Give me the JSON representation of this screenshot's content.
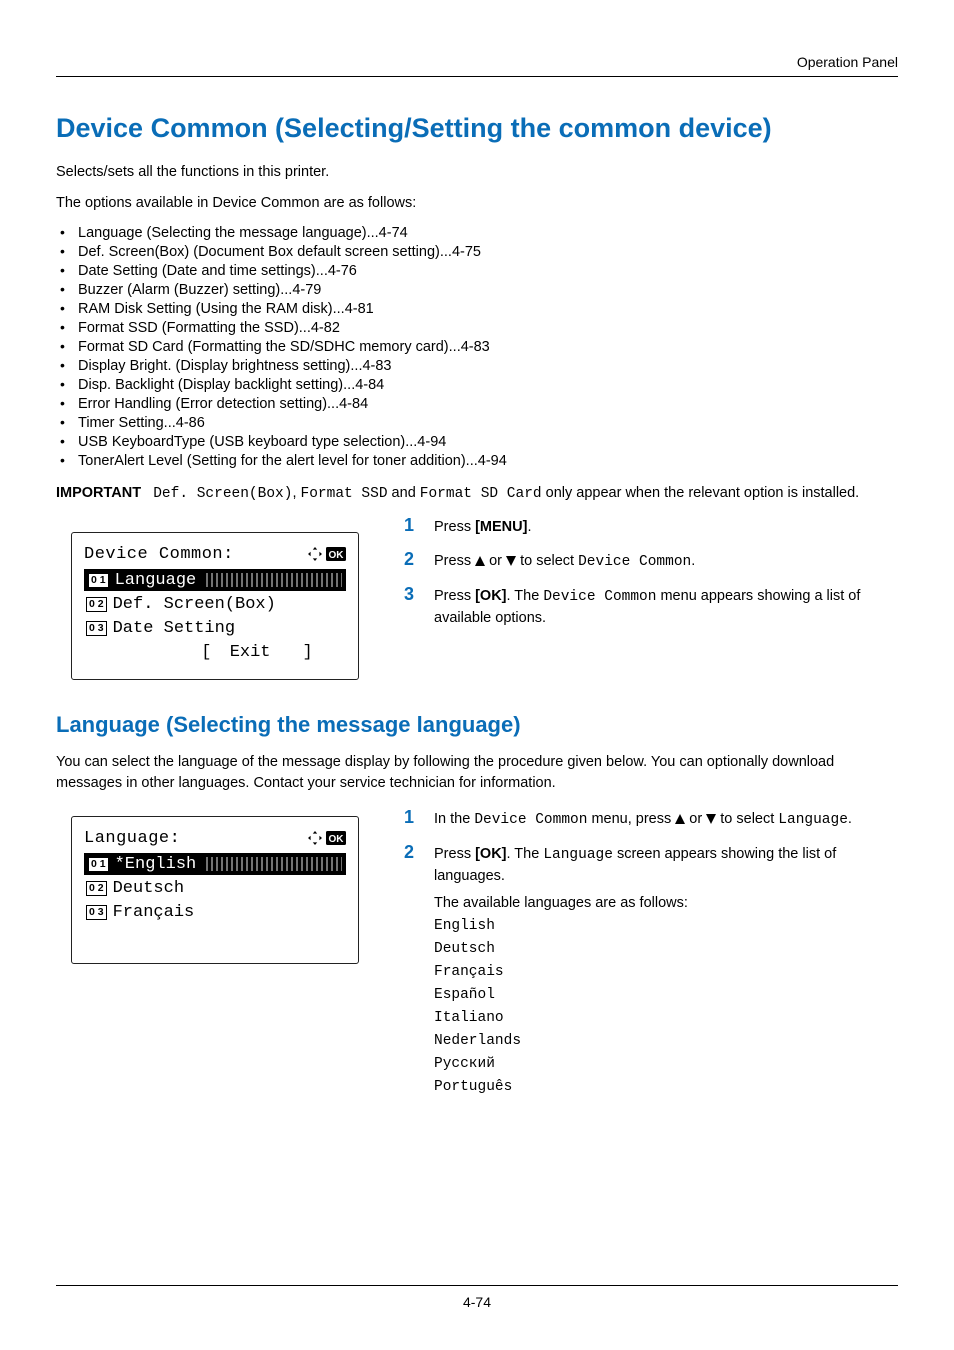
{
  "header": {
    "right": "Operation Panel"
  },
  "title": "Device Common (Selecting/Setting the common device)",
  "intro1": "Selects/sets all the functions in this printer.",
  "intro2": "The options available in Device Common are as follows:",
  "bullets": [
    "Language (Selecting the message language)...4-74",
    "Def. Screen(Box) (Document Box default screen setting)...4-75",
    "Date Setting (Date and time settings)...4-76",
    "Buzzer (Alarm (Buzzer) setting)...4-79",
    "RAM Disk Setting (Using the RAM disk)...4-81",
    "Format SSD (Formatting the SSD)...4-82",
    "Format SD Card (Formatting the SD/SDHC memory card)...4-83",
    "Display Bright. (Display brightness setting)...4-83",
    "Disp. Backlight (Display backlight setting)...4-84",
    "Error Handling (Error detection setting)...4-84",
    "Timer Setting...4-86",
    "USB KeyboardType (USB keyboard type selection)...4-94",
    "TonerAlert Level (Setting for the alert level for toner addition)...4-94"
  ],
  "important": {
    "label": "IMPORTANT",
    "code1": "Def. Screen(Box)",
    "sep1": ", ",
    "code2": "Format SSD",
    "mid": " and ",
    "code3": "Format SD Card",
    "tail": " only appear when the relevant option is installed."
  },
  "steps1": {
    "s1_pre": "Press ",
    "s1_btn": "[MENU]",
    "s1_post": ".",
    "s2_pre": "Press ",
    "s2_mid": " or ",
    "s2_post": " to select ",
    "s2_code": "Device Common",
    "s2_dot": ".",
    "s3_pre": "Press ",
    "s3_ok": "[OK]",
    "s3_mid": ". The ",
    "s3_code": "Device Common",
    "s3_post": " menu appears showing a list of available options."
  },
  "lcd1": {
    "title": "Device Common:",
    "row1_num": "0 1",
    "row1_label": "Language",
    "row2_num": "0 2",
    "row2_label": "Def. Screen(Box)",
    "row3_num": "0 3",
    "row3_label": "Date Setting",
    "footer_l": "[",
    "footer_text": "Exit",
    "footer_r": "]"
  },
  "h2": "Language (Selecting the message language)",
  "lang_intro": "You can select the language of the message display by following the procedure given below. You can optionally download messages in other languages. Contact your service technician for information.",
  "steps2": {
    "s1_pre": "In the ",
    "s1_code": "Device Common",
    "s1_mid": " menu, press ",
    "s1_mid2": " or ",
    "s1_post": " to select ",
    "s1_code2": "Language",
    "s1_dot": ".",
    "s2_pre": "Press ",
    "s2_ok": "[OK]",
    "s2_mid": ". The ",
    "s2_code": "Language",
    "s2_post": " screen appears showing the list of languages.",
    "s2_sub": "The available languages are as follows:"
  },
  "lcd2": {
    "title": "Language:",
    "row1_num": "0 1",
    "row1_label": "*English",
    "row2_num": "0 2",
    "row2_label": "Deutsch",
    "row3_num": "0 3",
    "row3_label": "Français"
  },
  "languages": [
    "English",
    "Deutsch",
    "Français",
    "Español",
    "Italiano",
    "Nederlands",
    "Русский",
    "Português"
  ],
  "pagenum": "4-74",
  "icons": {
    "ok": "OK"
  }
}
